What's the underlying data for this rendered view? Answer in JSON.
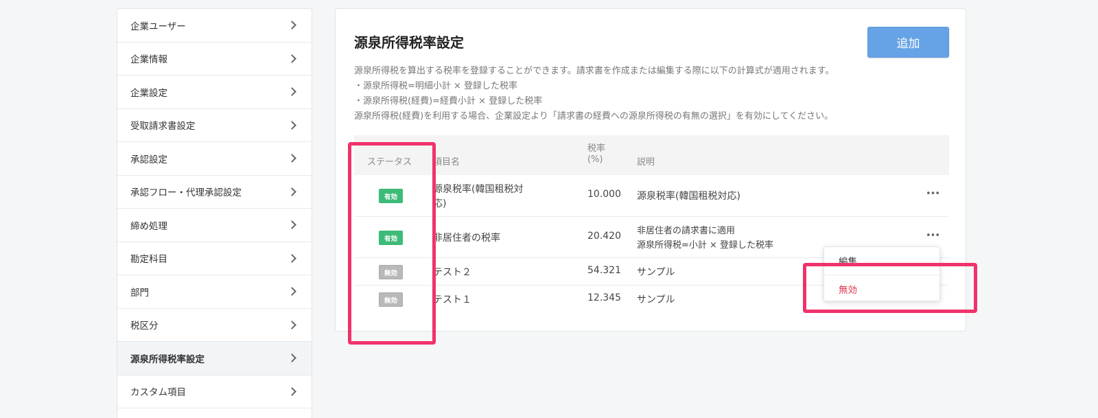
{
  "sidebar": {
    "items": [
      {
        "label": "企業ユーザー"
      },
      {
        "label": "企業情報"
      },
      {
        "label": "企業設定"
      },
      {
        "label": "受取請求書設定"
      },
      {
        "label": "承認設定"
      },
      {
        "label": "承認フロー・代理承認設定"
      },
      {
        "label": "締め処理"
      },
      {
        "label": "勘定科目"
      },
      {
        "label": "部門"
      },
      {
        "label": "税区分"
      },
      {
        "label": "源泉所得税率設定",
        "active": true
      },
      {
        "label": "カスタム項目"
      }
    ]
  },
  "main": {
    "title": "源泉所得税率設定",
    "add_label": "追加",
    "description": [
      "源泉所得税を算出する税率を登録することができます。請求書を作成または編集する際に以下の計算式が適用されます。",
      "・源泉所得税=明細小計 × 登録した税率",
      "・源泉所得税(経費)=経費小計 × 登録した税率",
      "源泉所得税(経費)を利用する場合、企業設定より「請求書の経費への源泉所得税の有無の選択」を有効にしてください。"
    ],
    "table": {
      "headers": {
        "status": "ステータス",
        "name": "項目名",
        "rate_line1": "税率",
        "rate_line2": "(%)",
        "description": "説明"
      },
      "rows": [
        {
          "status": "有効",
          "name_line1": "源泉税率(韓国租税対",
          "name_line2": "応)",
          "rate": "10.000",
          "desc_line1": "源泉税率(韓国租税対応)",
          "desc_line2": "",
          "menu": "•••"
        },
        {
          "status": "有効",
          "name_line1": "非居住者の税率",
          "name_line2": "",
          "rate": "20.420",
          "desc_line1": "非居住者の請求書に適用",
          "desc_line2": "源泉所得税=小計 × 登録した税率",
          "menu": "•••"
        },
        {
          "status": "無効",
          "name_line1": "テスト２",
          "name_line2": "",
          "rate": "54.321",
          "desc_line1": "サンプル",
          "desc_line2": ""
        },
        {
          "status": "無効",
          "name_line1": "テスト１",
          "name_line2": "",
          "rate": "12.345",
          "desc_line1": "サンプル",
          "desc_line2": ""
        }
      ]
    }
  },
  "dropdown": {
    "edit_label": "編集",
    "invalidate_label": "無効"
  },
  "colors": {
    "active_badge": "#3dbb78",
    "inactive_badge": "#b9b9b9",
    "add_button": "#66a3e6",
    "highlight": "#f0326a",
    "danger_text": "#e0334f"
  }
}
